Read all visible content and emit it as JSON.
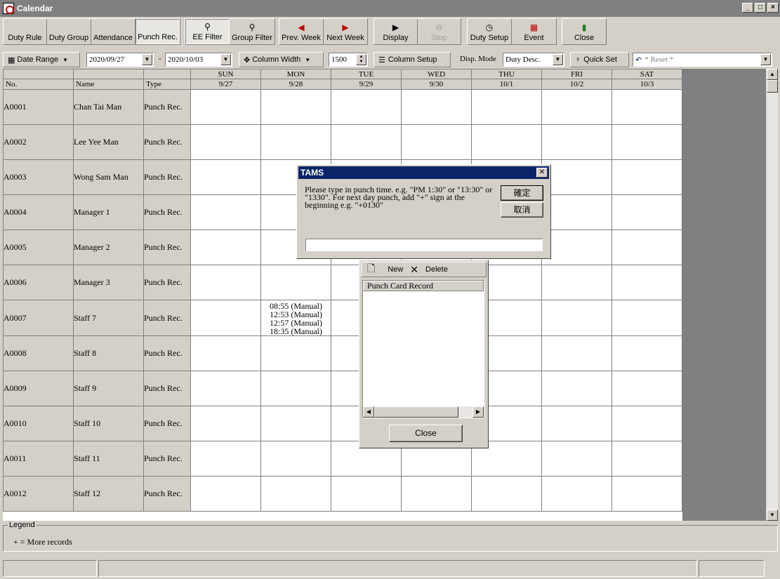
{
  "window": {
    "title": "Calendar"
  },
  "toolbar": {
    "buttons": [
      "Duty Rule",
      "Duty Group",
      "Attendance",
      "Punch Rec."
    ],
    "ee_filter": "EE Filter",
    "group_filter": "Group Filter",
    "prev_week": "Prev. Week",
    "next_week": "Next Week",
    "display": "Display",
    "stop": "Stop",
    "duty_setup": "Duty Setup",
    "event": "Event",
    "close": "Close"
  },
  "filter": {
    "date_range": "Date Range",
    "date_from": "2020/09/27",
    "separator": "-",
    "date_to": "2020/10/03",
    "column_width": "Column Width",
    "width_value": "1500",
    "column_setup": "Column Setup",
    "disp_mode_label": "Disp. Mode",
    "disp_mode_value": "Duty Desc.",
    "quick_set": "Quick Set",
    "reset": "* Reset *"
  },
  "grid": {
    "headers": {
      "no": "No.",
      "name": "Name",
      "type": "Type"
    },
    "days": [
      {
        "dow": "SUN",
        "date": "9/27"
      },
      {
        "dow": "MON",
        "date": "9/28"
      },
      {
        "dow": "TUE",
        "date": "9/29"
      },
      {
        "dow": "WED",
        "date": "9/30"
      },
      {
        "dow": "THU",
        "date": "10/1"
      },
      {
        "dow": "FRI",
        "date": "10/2"
      },
      {
        "dow": "SAT",
        "date": "10/3"
      }
    ],
    "rows": [
      {
        "no": "A0001",
        "name": "Chan Tai Man",
        "type": "Punch Rec."
      },
      {
        "no": "A0002",
        "name": "Lee Yee Man",
        "type": "Punch Rec."
      },
      {
        "no": "A0003",
        "name": "Wong Sam Man",
        "type": "Punch Rec."
      },
      {
        "no": "A0004",
        "name": "Manager 1",
        "type": "Punch Rec."
      },
      {
        "no": "A0005",
        "name": "Manager 2",
        "type": "Punch Rec."
      },
      {
        "no": "A0006",
        "name": "Manager 3",
        "type": "Punch Rec."
      },
      {
        "no": "A0007",
        "name": "Staff 7",
        "type": "Punch Rec."
      },
      {
        "no": "A0008",
        "name": "Staff 8",
        "type": "Punch Rec."
      },
      {
        "no": "A0009",
        "name": "Staff 9",
        "type": "Punch Rec."
      },
      {
        "no": "A0010",
        "name": "Staff 10",
        "type": "Punch Rec."
      },
      {
        "no": "A0011",
        "name": "Staff 11",
        "type": "Punch Rec."
      },
      {
        "no": "A0012",
        "name": "Staff 12",
        "type": "Punch Rec."
      }
    ],
    "punches": {
      "row": 6,
      "day": 1,
      "entries": [
        "08:55 (Manual)",
        "12:53 (Manual)",
        "12:57 (Manual)",
        "18:35 (Manual)"
      ]
    }
  },
  "legend": {
    "title": "Legend",
    "text": "+ = More records"
  },
  "punch_panel": {
    "new": "New",
    "delete": "Delete",
    "column": "Punch Card Record",
    "close": "Close"
  },
  "dialog": {
    "title": "TAMS",
    "message": "Please type in punch time. e.g. \"PM 1:30\" or \"13:30\" or \"1330\". For next day punch, add \"+\" sign at the beginning e.g. \"+0130\"",
    "ok": "確定",
    "cancel": "取消",
    "input_value": ""
  }
}
